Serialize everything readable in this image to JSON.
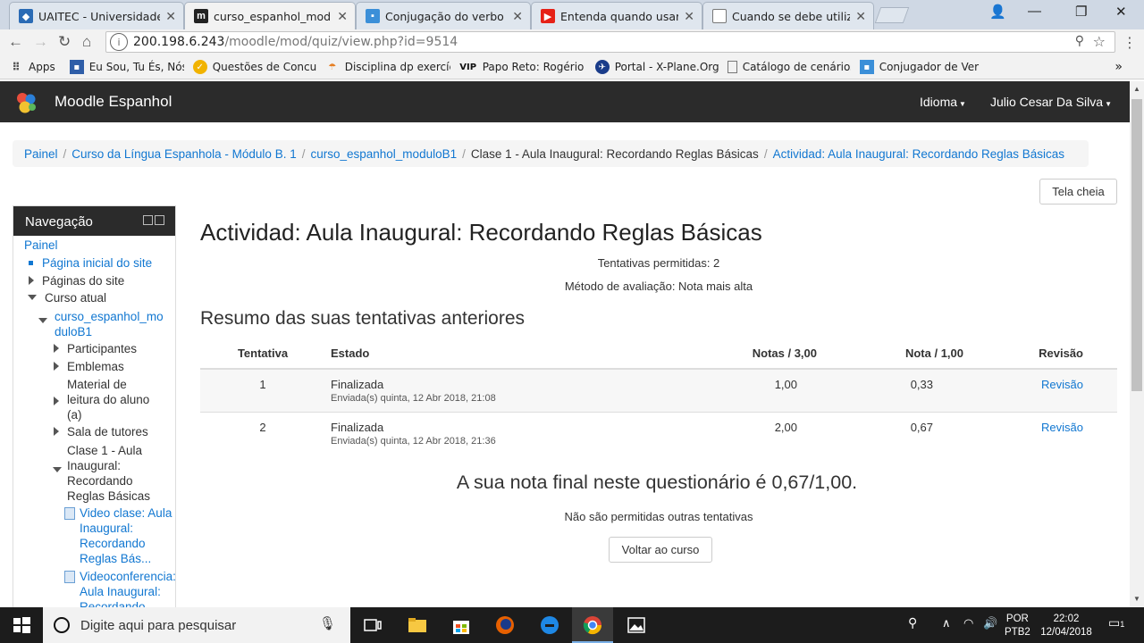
{
  "browser": {
    "tabs": [
      {
        "title": "UAITEC - Universidade A",
        "icon": "uaitec-favicon"
      },
      {
        "title": "curso_espanhol_moduloB",
        "icon": "moodle-favicon",
        "active": true
      },
      {
        "title": "Conjugação do verbo \"se",
        "icon": "conjugacao-favicon"
      },
      {
        "title": "Entenda quando usar ust",
        "icon": "youtube-favicon"
      },
      {
        "title": "Cuando se debe utilizar c",
        "icon": "page-favicon"
      }
    ],
    "close_glyph": "✕",
    "url_host": "200.198.6.243",
    "url_path": "/moodle/mod/quiz/view.php?id=9514",
    "bookmarks": [
      {
        "label": "Apps",
        "icon": "apps-grid-icon"
      },
      {
        "label": "Eu Sou, Tu És, Nós So",
        "icon": "bookmark-icon"
      },
      {
        "label": "Questões de Concurs",
        "icon": "bookmark-icon"
      },
      {
        "label": "Disciplina dp exercíci",
        "icon": "bookmark-icon"
      },
      {
        "label": "Papo Reto: Rogério F",
        "icon": "vip-icon"
      },
      {
        "label": "Portal - X-Plane.Org I",
        "icon": "bookmark-icon"
      },
      {
        "label": "Catálogo de cenários",
        "icon": "page-icon"
      },
      {
        "label": "Conjugador de Verbo",
        "icon": "bookmark-icon"
      }
    ],
    "bookmarks_more": "»",
    "vip_label": "VIP"
  },
  "moodle": {
    "brand": "Moodle Espanhol",
    "language_menu": "Idioma",
    "user_menu": "Julio Cesar Da Silva"
  },
  "breadcrumb": [
    {
      "label": "Painel",
      "link": true
    },
    {
      "label": "Curso da Língua Espanhola - Módulo B. 1",
      "link": true
    },
    {
      "label": "curso_espanhol_moduloB1",
      "link": true
    },
    {
      "label": "Clase 1 - Aula Inaugural: Recordando Reglas Básicas",
      "link": false
    },
    {
      "label": "Actividad: Aula Inaugural: Recordando Reglas Básicas",
      "link": true
    }
  ],
  "fullscreen_button": "Tela cheia",
  "navigation": {
    "title": "Navegação",
    "items": {
      "painel": "Painel",
      "home": "Página inicial do site",
      "site_pages": "Páginas do site",
      "current_course": "Curso atual",
      "course_line1": "curso_espanhol_mo",
      "course_line2": "duloB1",
      "participants": "Participantes",
      "badges": "Emblemas",
      "reading_l1": "Material de",
      "reading_l2": "leitura do aluno",
      "reading_l3": "(a)",
      "tutors": "Sala de tutores",
      "clase_l1": "Clase 1 - Aula",
      "clase_l2": "Inaugural:",
      "clase_l3": "Recordando",
      "clase_l4": "Reglas Básicas",
      "video_l1": "Video clase: Aula",
      "video_l2": "Inaugural:",
      "video_l3": "Recordando",
      "video_l4": "Reglas Bás...",
      "vconf_l1": "Videoconferencia:",
      "vconf_l2": "Aula Inaugural:",
      "vconf_l3": "Recordando"
    }
  },
  "quiz": {
    "title": "Actividad: Aula Inaugural: Recordando Reglas Básicas",
    "attempts_allowed": "Tentativas permitidas: 2",
    "grading_method": "Método de avaliação: Nota mais alta",
    "summary_heading": "Resumo das suas tentativas anteriores",
    "columns": [
      "Tentativa",
      "Estado",
      "Notas / 3,00",
      "Nota / 1,00",
      "Revisão"
    ],
    "attempts": [
      {
        "num": "1",
        "state": "Finalizada",
        "submitted": "Enviada(s) quinta, 12 Abr 2018, 21:08",
        "marks": "1,00",
        "grade": "0,33",
        "review": "Revisão"
      },
      {
        "num": "2",
        "state": "Finalizada",
        "submitted": "Enviada(s) quinta, 12 Abr 2018, 21:36",
        "marks": "2,00",
        "grade": "0,67",
        "review": "Revisão"
      }
    ],
    "final_grade": "A sua nota final neste questionário é 0,67/1,00.",
    "no_more_attempts": "Não são permitidas outras tentativas",
    "back_button": "Voltar ao curso"
  },
  "taskbar": {
    "search_placeholder": "Digite aqui para pesquisar",
    "lang_line1": "POR",
    "lang_line2": "PTB2",
    "time": "22:02",
    "date": "12/04/2018",
    "notification_count": "1"
  }
}
